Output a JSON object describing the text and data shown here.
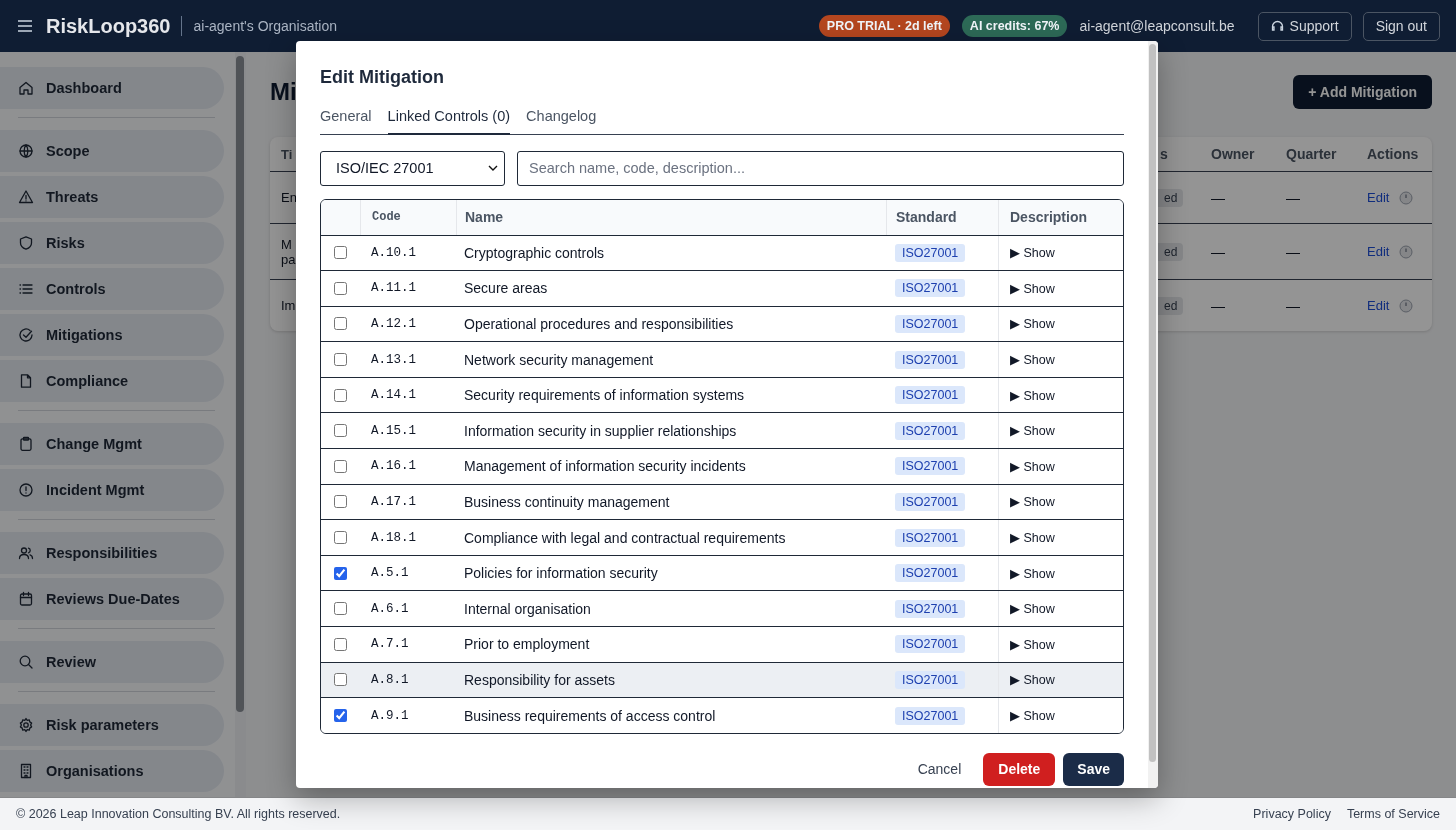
{
  "top_bar": {
    "app_name": "RiskLoop360",
    "organisation": "ai-agent's Organisation",
    "badges": [
      {
        "text": "PRO TRIAL · 2d left",
        "color": "#b4461f"
      },
      {
        "text": "AI credits: 67%",
        "color": "#2d6a57"
      }
    ],
    "user_email": "ai-agent@leapconsult.be",
    "support_button": "Support",
    "sign_out_button": "Sign out"
  },
  "sidebar": {
    "groups": [
      [
        "Dashboard"
      ],
      [
        "Scope",
        "Threats",
        "Risks",
        "Controls",
        "Mitigations",
        "Compliance"
      ],
      [
        "Change Mgmt",
        "Incident Mgmt"
      ],
      [
        "Responsibilities",
        "Reviews Due-Dates"
      ],
      [
        "Review"
      ],
      [
        "Risk parameters",
        "Organisations"
      ]
    ]
  },
  "page": {
    "title": "Mi",
    "add_button": "+ Add Mitigation",
    "table": {
      "columns": [
        "Ti",
        "s",
        "Owner",
        "Quarter",
        "Actions"
      ],
      "rows": [
        {
          "title_lines": [
            "En"
          ],
          "status": "ed",
          "owner": "—",
          "quarter": "—",
          "action": "Edit"
        },
        {
          "title_lines": [
            "M",
            "pa"
          ],
          "status": "ed",
          "owner": "—",
          "quarter": "—",
          "action": "Edit"
        },
        {
          "title_lines": [
            "Im"
          ],
          "status": "ed",
          "owner": "—",
          "quarter": "—",
          "action": "Edit"
        }
      ]
    }
  },
  "modal": {
    "title": "Edit Mitigation",
    "tabs": [
      {
        "label": "General",
        "selected": false
      },
      {
        "label": "Linked Controls (0)",
        "selected": true
      },
      {
        "label": "Changelog",
        "selected": false
      }
    ],
    "standard_select": "ISO/IEC 27001",
    "search": {
      "placeholder": "Search name, code, description..."
    },
    "table": {
      "columns": [
        "Code",
        "Name",
        "Standard",
        "Description"
      ],
      "rows": [
        {
          "checked": false,
          "highlighted": false,
          "code": "A.10.1",
          "name": "Cryptographic controls",
          "standard": "ISO27001",
          "description": "▶ Show"
        },
        {
          "checked": false,
          "highlighted": false,
          "code": "A.11.1",
          "name": "Secure areas",
          "standard": "ISO27001",
          "description": "▶ Show"
        },
        {
          "checked": false,
          "highlighted": false,
          "code": "A.12.1",
          "name": "Operational procedures and responsibilities",
          "standard": "ISO27001",
          "description": "▶ Show"
        },
        {
          "checked": false,
          "highlighted": false,
          "code": "A.13.1",
          "name": "Network security management",
          "standard": "ISO27001",
          "description": "▶ Show"
        },
        {
          "checked": false,
          "highlighted": false,
          "code": "A.14.1",
          "name": "Security requirements of information systems",
          "standard": "ISO27001",
          "description": "▶ Show"
        },
        {
          "checked": false,
          "highlighted": false,
          "code": "A.15.1",
          "name": "Information security in supplier relationships",
          "standard": "ISO27001",
          "description": "▶ Show"
        },
        {
          "checked": false,
          "highlighted": false,
          "code": "A.16.1",
          "name": "Management of information security incidents",
          "standard": "ISO27001",
          "description": "▶ Show"
        },
        {
          "checked": false,
          "highlighted": false,
          "code": "A.17.1",
          "name": "Business continuity management",
          "standard": "ISO27001",
          "description": "▶ Show"
        },
        {
          "checked": false,
          "highlighted": false,
          "code": "A.18.1",
          "name": "Compliance with legal and contractual requirements",
          "standard": "ISO27001",
          "description": "▶ Show"
        },
        {
          "checked": true,
          "highlighted": false,
          "code": "A.5.1",
          "name": "Policies for information security",
          "standard": "ISO27001",
          "description": "▶ Show"
        },
        {
          "checked": false,
          "highlighted": false,
          "code": "A.6.1",
          "name": "Internal organisation",
          "standard": "ISO27001",
          "description": "▶ Show"
        },
        {
          "checked": false,
          "highlighted": false,
          "code": "A.7.1",
          "name": "Prior to employment",
          "standard": "ISO27001",
          "description": "▶ Show"
        },
        {
          "checked": false,
          "highlighted": true,
          "code": "A.8.1",
          "name": "Responsibility for assets",
          "standard": "ISO27001",
          "description": "▶ Show"
        },
        {
          "checked": true,
          "highlighted": false,
          "code": "A.9.1",
          "name": "Business requirements of access control",
          "standard": "ISO27001",
          "description": "▶ Show"
        }
      ]
    },
    "buttons": [
      {
        "label": "Cancel",
        "kind": "plain"
      },
      {
        "label": "Delete",
        "kind": "danger"
      },
      {
        "label": "Save",
        "kind": "primary"
      }
    ]
  },
  "footer": {
    "copyright": "© 2026 Leap Innovation Consulting BV. All rights reserved.",
    "links": [
      "Privacy Policy",
      "Terms of Service"
    ]
  }
}
